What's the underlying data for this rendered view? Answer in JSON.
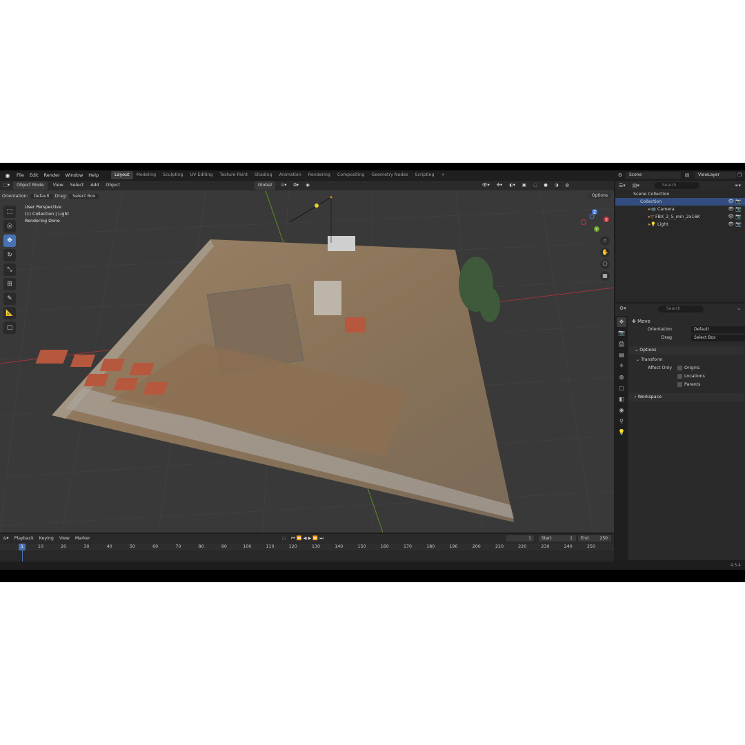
{
  "menu": [
    "File",
    "Edit",
    "Render",
    "Window",
    "Help"
  ],
  "workspaces": [
    {
      "label": "Layout",
      "active": true
    },
    {
      "label": "Modeling"
    },
    {
      "label": "Sculpting"
    },
    {
      "label": "UV Editing"
    },
    {
      "label": "Texture Paint"
    },
    {
      "label": "Shading"
    },
    {
      "label": "Animation"
    },
    {
      "label": "Rendering"
    },
    {
      "label": "Compositing"
    },
    {
      "label": "Geometry Nodes"
    },
    {
      "label": "Scripting"
    },
    {
      "label": "+"
    }
  ],
  "scene": {
    "label": "Scene",
    "view_layer": "ViewLayer"
  },
  "viewport": {
    "mode": "Object Mode",
    "menus": [
      "View",
      "Select",
      "Add",
      "Object"
    ],
    "transform_orientation": "Global",
    "orientation_label": "Orientation:",
    "orientation_value": "Default",
    "drag_label": "Drag:",
    "drag_value": "Select Box",
    "options": "Options",
    "info": [
      "User Perspective",
      "(1) Collection | Light",
      "Rendering Done"
    ],
    "gizmo": {
      "x": "X",
      "y": "Y",
      "z": "Z"
    }
  },
  "outliner": {
    "search_placeholder": "Search",
    "root": "Scene Collection",
    "collection": "Collection",
    "items": [
      "Camera",
      "FBX_2_5_min_2x16K",
      "Light"
    ]
  },
  "properties": {
    "search_placeholder": "Search",
    "tool": "Move",
    "orientation_label": "Orientation",
    "orientation_value": "Default",
    "drag_label": "Drag",
    "drag_value": "Select Box",
    "options_panel": "Options",
    "transform_panel": "Transform",
    "affect_only_label": "Affect Only",
    "affect_options": [
      "Origins",
      "Locations",
      "Parents"
    ],
    "workspace_panel": "Workspace"
  },
  "timeline": {
    "menus": [
      "Playback",
      "Keying",
      "View",
      "Marker"
    ],
    "current_frame": "1",
    "start_label": "Start",
    "start": "1",
    "end_label": "End",
    "end": "250",
    "ticks": [
      "1",
      "10",
      "20",
      "30",
      "40",
      "50",
      "60",
      "70",
      "80",
      "90",
      "100",
      "110",
      "120",
      "130",
      "140",
      "150",
      "160",
      "170",
      "180",
      "190",
      "200",
      "210",
      "220",
      "230",
      "240",
      "250"
    ]
  },
  "version": "4.5.4",
  "colors": {
    "accent": "#4772b3",
    "axis_x": "#c9353d",
    "axis_y": "#6ca32a",
    "axis_z": "#4a7ddb"
  }
}
